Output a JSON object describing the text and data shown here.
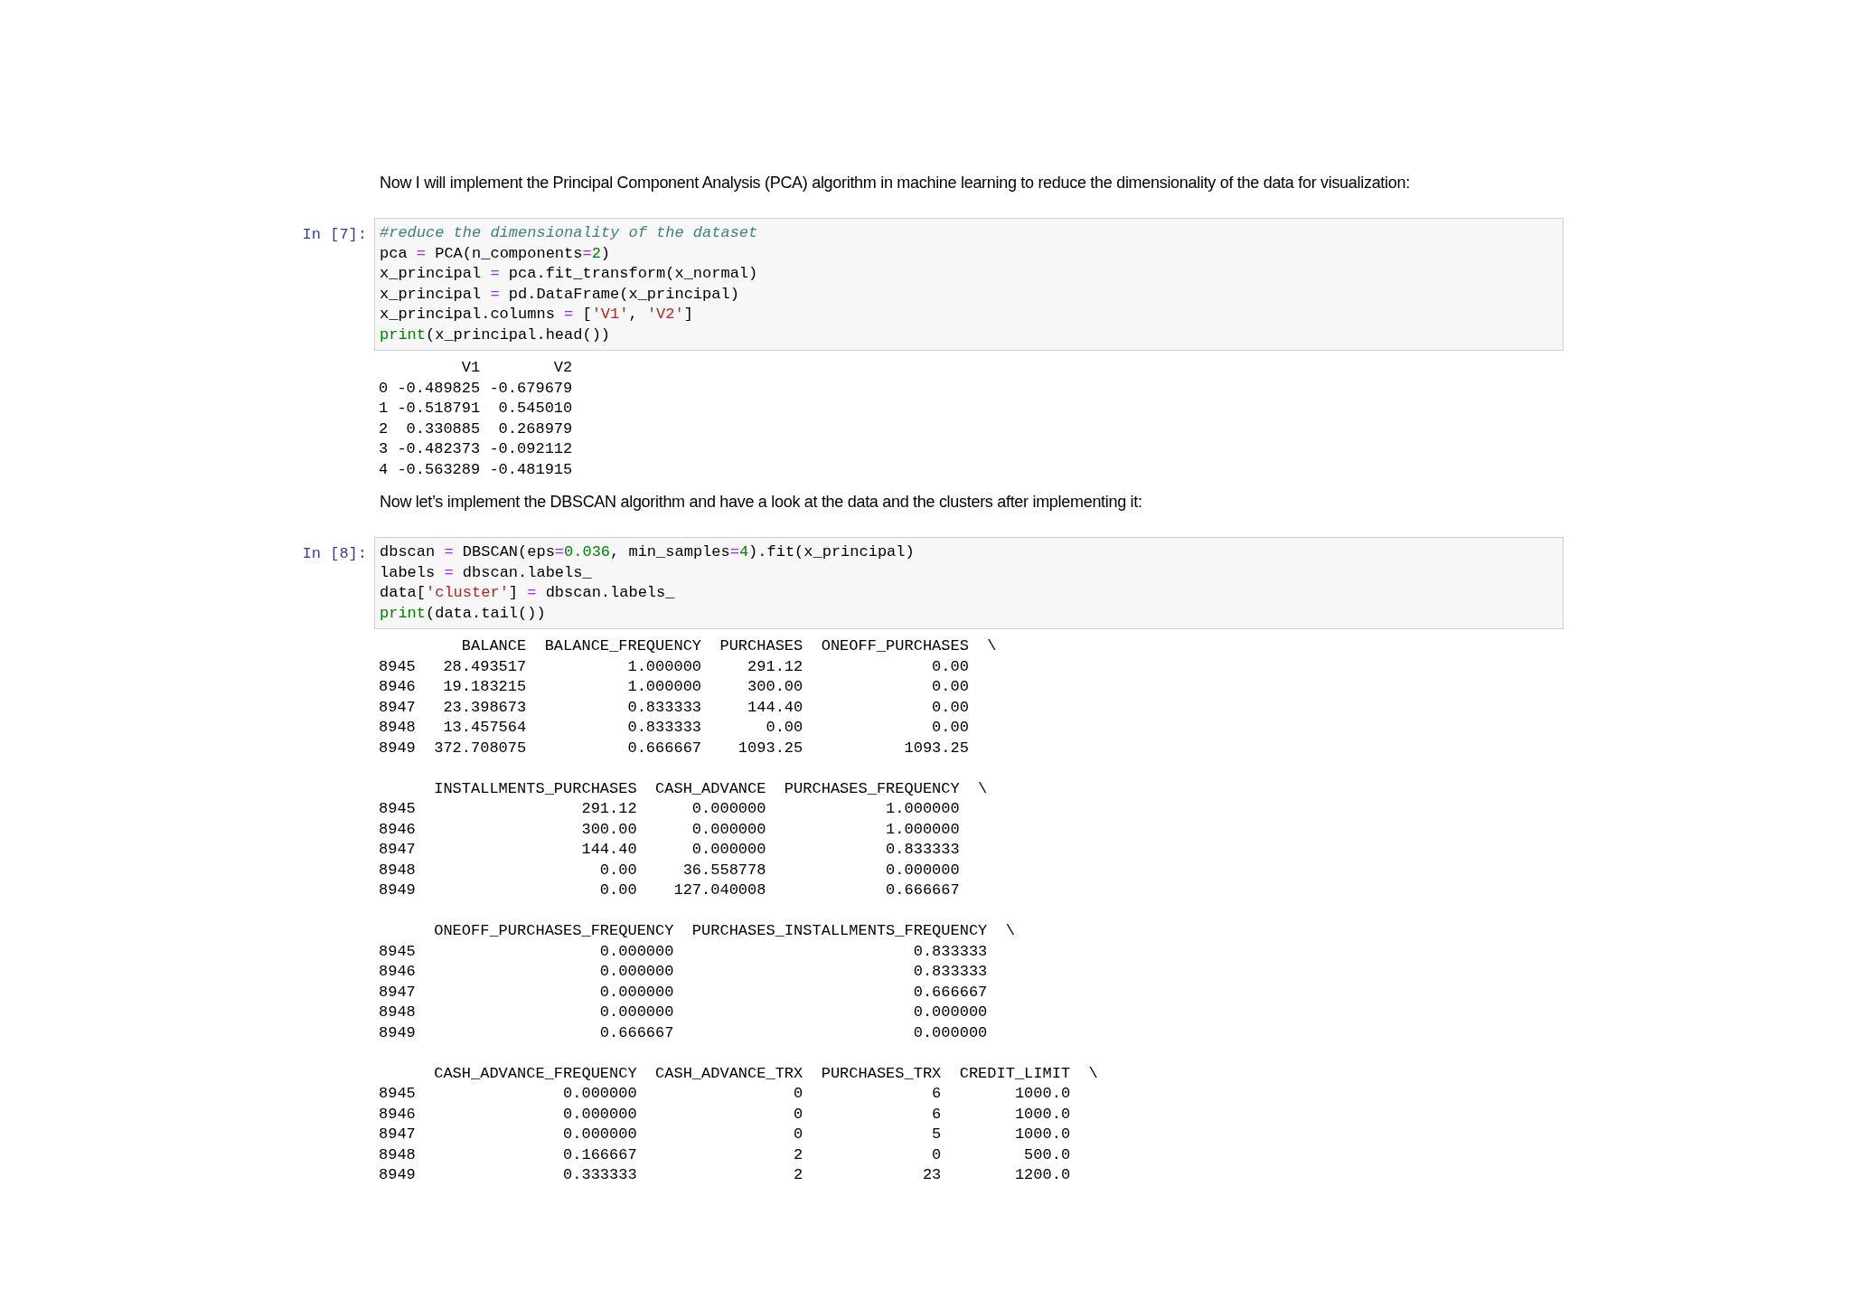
{
  "cells": [
    {
      "kind": "markdown",
      "text": "Now I will implement the Principal Component Analysis (PCA) algorithm in machine learning to reduce the dimensionality of the data for visualization:"
    },
    {
      "kind": "code",
      "prompt": "In [7]:",
      "source": [
        [
          {
            "text": "#reduce the dimensionality of the dataset",
            "kind": "comment"
          }
        ],
        [
          {
            "text": "pca ",
            "kind": "plain"
          },
          {
            "text": "=",
            "kind": "op"
          },
          {
            "text": " PCA(n_components",
            "kind": "plain"
          },
          {
            "text": "=",
            "kind": "op"
          },
          {
            "text": "2",
            "kind": "number"
          },
          {
            "text": ")",
            "kind": "plain"
          }
        ],
        [
          {
            "text": "x_principal ",
            "kind": "plain"
          },
          {
            "text": "=",
            "kind": "op"
          },
          {
            "text": " pca.fit_transform(x_normal)",
            "kind": "plain"
          }
        ],
        [
          {
            "text": "x_principal ",
            "kind": "plain"
          },
          {
            "text": "=",
            "kind": "op"
          },
          {
            "text": " pd.DataFrame(x_principal)",
            "kind": "plain"
          }
        ],
        [
          {
            "text": "x_principal.columns ",
            "kind": "plain"
          },
          {
            "text": "=",
            "kind": "op"
          },
          {
            "text": " [",
            "kind": "plain"
          },
          {
            "text": "'V1'",
            "kind": "string"
          },
          {
            "text": ", ",
            "kind": "plain"
          },
          {
            "text": "'V2'",
            "kind": "string"
          },
          {
            "text": "]",
            "kind": "plain"
          }
        ],
        [
          {
            "text": "print",
            "kind": "builtin"
          },
          {
            "text": "(x_principal.head())",
            "kind": "plain"
          }
        ]
      ],
      "output": [
        {
          "lines": [
            "         V1        V2",
            "0 -0.489825 -0.679679",
            "1 -0.518791  0.545010",
            "2  0.330885  0.268979",
            "3 -0.482373 -0.092112",
            "4 -0.563289 -0.481915"
          ]
        }
      ]
    },
    {
      "kind": "markdown",
      "text": "Now let’s implement the DBSCAN algorithm and have a look at the data and the clusters after implementing it:"
    },
    {
      "kind": "code",
      "prompt": "In [8]:",
      "source": [
        [
          {
            "text": "dbscan ",
            "kind": "plain"
          },
          {
            "text": "=",
            "kind": "op"
          },
          {
            "text": " DBSCAN(eps",
            "kind": "plain"
          },
          {
            "text": "=",
            "kind": "op"
          },
          {
            "text": "0.036",
            "kind": "number"
          },
          {
            "text": ", min_samples",
            "kind": "plain"
          },
          {
            "text": "=",
            "kind": "op"
          },
          {
            "text": "4",
            "kind": "number"
          },
          {
            "text": ").fit(x_principal)",
            "kind": "plain"
          }
        ],
        [
          {
            "text": "labels ",
            "kind": "plain"
          },
          {
            "text": "=",
            "kind": "op"
          },
          {
            "text": " dbscan.labels_",
            "kind": "plain"
          }
        ],
        [
          {
            "text": "data[",
            "kind": "plain"
          },
          {
            "text": "'cluster'",
            "kind": "string"
          },
          {
            "text": "] ",
            "kind": "plain"
          },
          {
            "text": "=",
            "kind": "op"
          },
          {
            "text": " dbscan.labels_",
            "kind": "plain"
          }
        ],
        [
          {
            "text": "print",
            "kind": "builtin"
          },
          {
            "text": "(data.tail())",
            "kind": "plain"
          }
        ]
      ],
      "output": [
        {
          "lines": [
            "         BALANCE  BALANCE_FREQUENCY  PURCHASES  ONEOFF_PURCHASES  \\",
            "8945   28.493517           1.000000     291.12              0.00",
            "8946   19.183215           1.000000     300.00              0.00",
            "8947   23.398673           0.833333     144.40              0.00",
            "8948   13.457564           0.833333       0.00              0.00",
            "8949  372.708075           0.666667    1093.25           1093.25"
          ]
        },
        {
          "lines": [
            "      INSTALLMENTS_PURCHASES  CASH_ADVANCE  PURCHASES_FREQUENCY  \\",
            "8945                  291.12      0.000000             1.000000",
            "8946                  300.00      0.000000             1.000000",
            "8947                  144.40      0.000000             0.833333",
            "8948                    0.00     36.558778             0.000000",
            "8949                    0.00    127.040008             0.666667"
          ]
        },
        {
          "lines": [
            "      ONEOFF_PURCHASES_FREQUENCY  PURCHASES_INSTALLMENTS_FREQUENCY  \\",
            "8945                    0.000000                          0.833333",
            "8946                    0.000000                          0.833333",
            "8947                    0.000000                          0.666667",
            "8948                    0.000000                          0.000000",
            "8949                    0.666667                          0.000000"
          ]
        },
        {
          "lines": [
            "      CASH_ADVANCE_FREQUENCY  CASH_ADVANCE_TRX  PURCHASES_TRX  CREDIT_LIMIT  \\",
            "8945                0.000000                 0              6        1000.0",
            "8946                0.000000                 0              6        1000.0",
            "8947                0.000000                 0              5        1000.0",
            "8948                0.166667                 2              0         500.0",
            "8949                0.333333                 2             23        1200.0"
          ]
        }
      ]
    }
  ]
}
